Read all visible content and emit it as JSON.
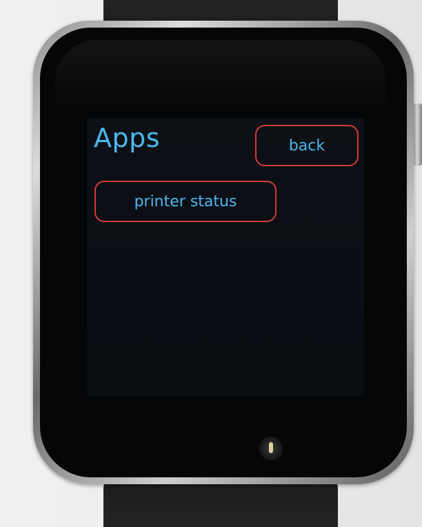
{
  "screen": {
    "title": "Apps",
    "back_label": "back",
    "apps": [
      {
        "label": "printer status"
      }
    ]
  },
  "colors": {
    "text_accent": "#4fb6ec",
    "button_border": "#d23b3b",
    "screen_background": "#0c1016"
  }
}
